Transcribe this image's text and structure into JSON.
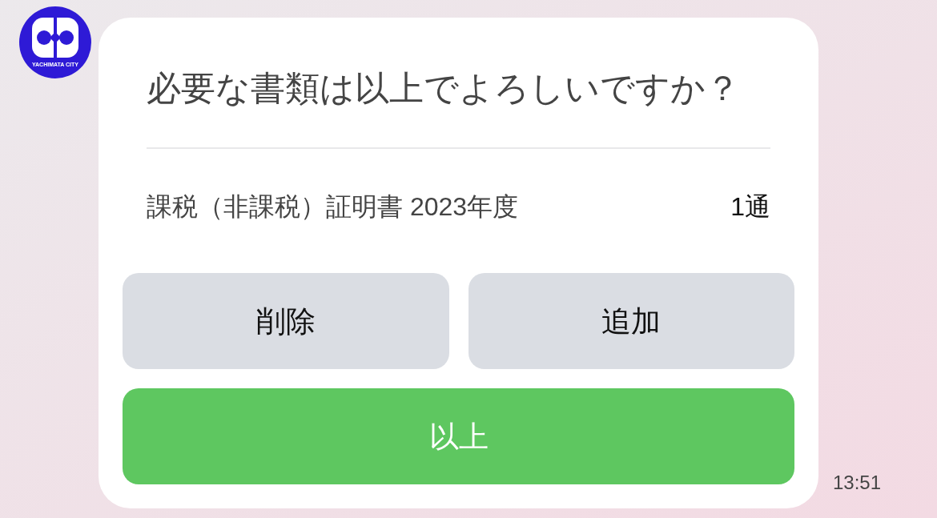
{
  "logo": {
    "caption": "YACHIMATA CITY"
  },
  "card": {
    "question": "必要な書類は以上でよろしいですか？",
    "items": [
      {
        "name": "課税（非課税）証明書 2023年度",
        "quantity": "1通"
      }
    ],
    "buttons": [
      {
        "label": "削除",
        "kind": "secondary"
      },
      {
        "label": "追加",
        "kind": "secondary"
      },
      {
        "label": "以上",
        "kind": "primary"
      }
    ]
  },
  "timestamp": "13:51"
}
